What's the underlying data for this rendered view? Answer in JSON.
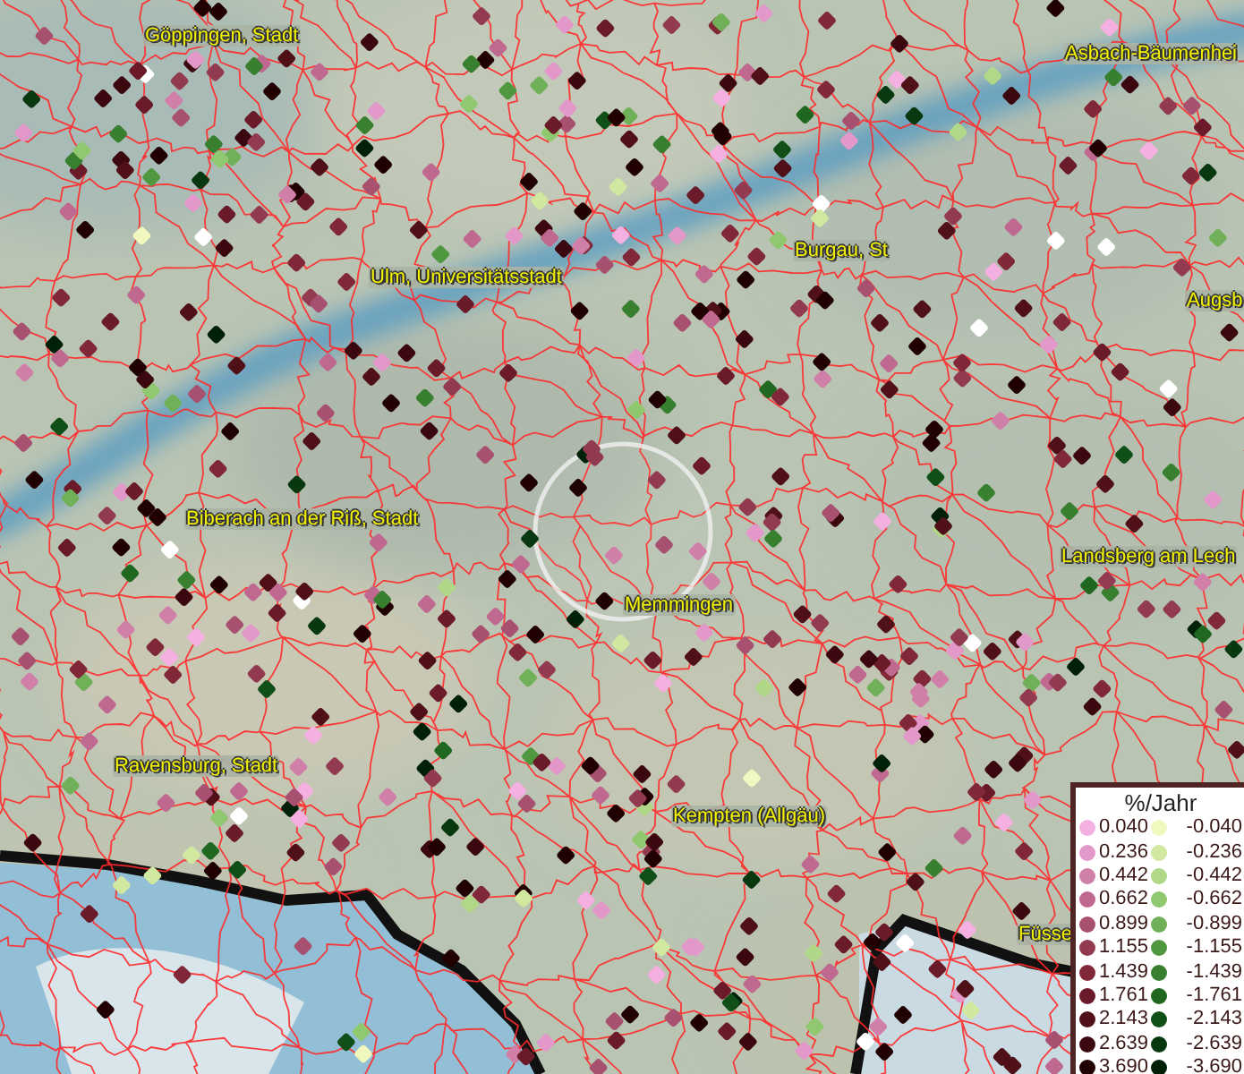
{
  "map": {
    "labels": [
      {
        "text": "Göppingen, Stadt"
      },
      {
        "text": "Asbach-Bäumenhei"
      },
      {
        "text": "Ulm, Universitätsstadt"
      },
      {
        "text": "Burgau, St"
      },
      {
        "text": "Augsb"
      },
      {
        "text": "Biberach an der Riß, Stadt"
      },
      {
        "text": "Memmingen"
      },
      {
        "text": "Landsberg am Lech"
      },
      {
        "text": "Ravensburg, Stadt"
      },
      {
        "text": "Kempten (Allgäu)"
      },
      {
        "text": "Füsse"
      }
    ]
  },
  "legend": {
    "title": "%/Jahr",
    "columns": [
      {
        "items": [
          {
            "label": "0.040",
            "color": "#f4b0e0"
          },
          {
            "label": "0.236",
            "color": "#e298c8"
          },
          {
            "label": "0.442",
            "color": "#d080a8"
          },
          {
            "label": "0.662",
            "color": "#bf6890"
          },
          {
            "label": "0.899",
            "color": "#a85070"
          },
          {
            "label": "1.155",
            "color": "#923a50"
          },
          {
            "label": "1.439",
            "color": "#802838"
          },
          {
            "label": "1.761",
            "color": "#6a1a28"
          },
          {
            "label": "2.143",
            "color": "#501018"
          },
          {
            "label": "2.639",
            "color": "#3c0810"
          },
          {
            "label": "3.690",
            "color": "#200000"
          }
        ]
      },
      {
        "items": [
          {
            "label": "-0.040",
            "color": "#f0f8c0"
          },
          {
            "label": "-0.236",
            "color": "#d0e8a0"
          },
          {
            "label": "-0.442",
            "color": "#b0d888"
          },
          {
            "label": "-0.662",
            "color": "#90c870"
          },
          {
            "label": "-0.899",
            "color": "#70b058"
          },
          {
            "label": "-1.155",
            "color": "#509840"
          },
          {
            "label": "-1.439",
            "color": "#388030"
          },
          {
            "label": "-1.761",
            "color": "#206820"
          },
          {
            "label": "-2.143",
            "color": "#105018"
          },
          {
            "label": "-2.639",
            "color": "#083810"
          },
          {
            "label": "-3.690",
            "color": "#002008"
          }
        ]
      }
    ]
  }
}
